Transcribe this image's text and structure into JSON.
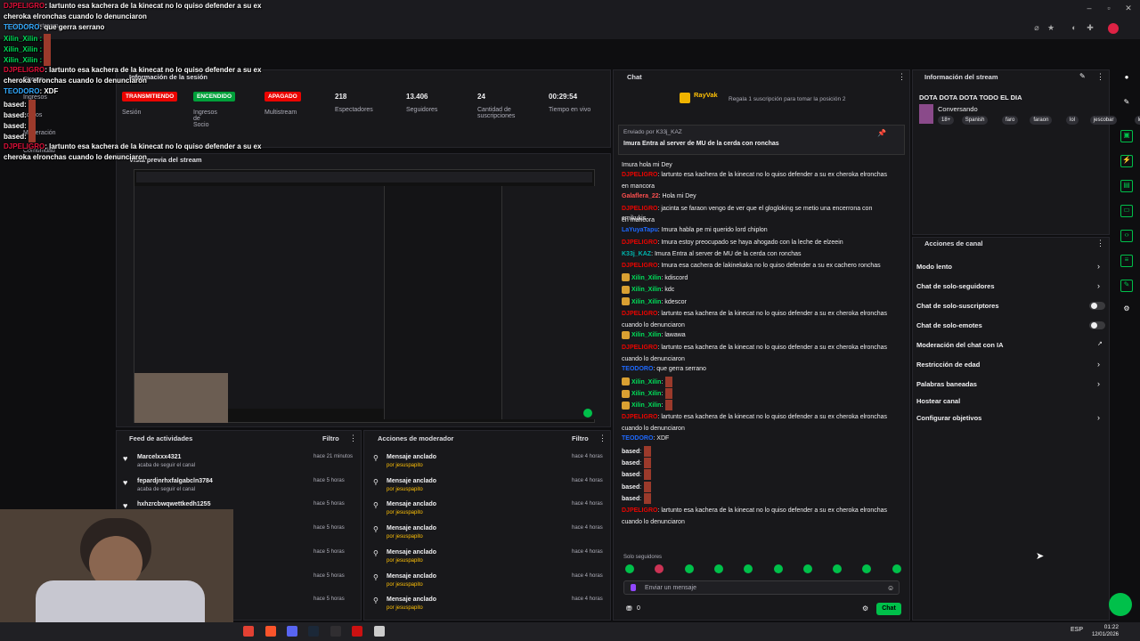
{
  "browser": {
    "url": "twitch.tv/…/stream"
  },
  "overlay": {
    "lines": [
      {
        "user": "DJPELIGRO",
        "text": ": lartunto esa kachera de la kinecat no lo quiso defender a su ex",
        "cont": "cheroka elronchas cuando lo denunciaron"
      },
      {
        "user": "TEODORO",
        "text": ": que gerra serrano"
      },
      {
        "user": "Xilin_Xilin :",
        "text": ""
      },
      {
        "user": "Xilin_Xilin :",
        "text": ""
      },
      {
        "user": "Xilin_Xilin :",
        "text": ""
      },
      {
        "user": "DJPELIGRO",
        "text": ": lartunto esa kachera de la kinecat no lo quiso defender a su ex",
        "cont": "cheroka elronchas cuando lo denunciaron"
      },
      {
        "user": "TEODORO",
        "text": ": XDF"
      },
      {
        "user": "based:",
        "text": ""
      },
      {
        "user": "based:",
        "text": ""
      },
      {
        "user": "based:",
        "text": ""
      },
      {
        "user": "based:",
        "text": ""
      },
      {
        "user": "DJPELIGRO",
        "text": ": lartunto esa kachera de la kinecat no lo quiso defender a su ex",
        "cont": "cheroka elronchas cuando lo denunciaron"
      }
    ]
  },
  "left_nav": [
    "Stream",
    "Ingresos",
    "Logros",
    "Moderación",
    "Comunidad"
  ],
  "session": {
    "title": "Información de la sesión",
    "badges": [
      {
        "label": "TRANSMITIENDO",
        "sub": "Sesión",
        "color": "#eb0400"
      },
      {
        "label": "ENCENDIDO",
        "sub": "Ingresos de Socio",
        "color": "#00a03a"
      },
      {
        "label": "APAGADO",
        "sub": "Multistream",
        "color": "#eb0400"
      }
    ],
    "stats": [
      {
        "num": "218",
        "lbl": "Espectadores"
      },
      {
        "num": "13.406",
        "lbl": "Seguidores"
      },
      {
        "num": "24",
        "lbl": "Cantidad de suscripciones"
      },
      {
        "num": "00:29:54",
        "lbl": "Tiempo en vivo"
      }
    ]
  },
  "preview": {
    "title": "Vista previa del stream"
  },
  "feed": {
    "title": "Feed de actividades",
    "filter": "Filtro",
    "items": [
      {
        "name": "Marcelxxx4321",
        "sub": "acaba de seguir el canal",
        "time": "hace 21 minutos"
      },
      {
        "name": "fepardjnrhxfalgabcln3784",
        "sub": "acaba de seguir el canal",
        "time": "hace 5 horas"
      },
      {
        "name": "hxhzrcbwqwettkedh1255",
        "sub": "",
        "time": "hace 5 horas"
      },
      {
        "name": "",
        "sub": "",
        "time": "hace 5 horas"
      },
      {
        "name": "",
        "sub": "",
        "time": "hace 5 horas"
      },
      {
        "name": "",
        "sub": "",
        "time": "hace 5 horas"
      },
      {
        "name": "",
        "sub": "",
        "time": "hace 5 horas"
      }
    ]
  },
  "mod": {
    "title": "Acciones de moderador",
    "filter": "Filtro",
    "items": [
      {
        "name": "Mensaje anclado",
        "by": "por jesuspapito",
        "time": "hace 4 horas"
      },
      {
        "name": "Mensaje anclado",
        "by": "por jesuspapito",
        "time": "hace 4 horas"
      },
      {
        "name": "Mensaje anclado",
        "by": "por jesuspapito",
        "time": "hace 4 horas"
      },
      {
        "name": "Mensaje anclado",
        "by": "por jesuspapito",
        "time": "hace 4 horas"
      },
      {
        "name": "Mensaje anclado",
        "by": "por jesuspapito",
        "time": "hace 4 horas"
      },
      {
        "name": "Mensaje anclado",
        "by": "por jesuspapito",
        "time": "hace 4 horas"
      },
      {
        "name": "Mensaje anclado",
        "by": "por jesuspapito",
        "time": "hace 4 horas"
      }
    ]
  },
  "chat": {
    "title": "Chat",
    "top_user": "RayVak",
    "gift_note": "Regala 1 suscripción para tomar la posición 2",
    "pinned_by": "Enviado por K33j_KAZ",
    "pinned_text": "Imura Entra al server de MU de la cerda con ronchas",
    "messages": [
      {
        "user": "",
        "text": "Imura hola mi Dey",
        "color": "#eb0400"
      },
      {
        "user": "DJPELIGRO",
        "text": ": lartunto esa kachera de la kinecat no lo quiso defender a su ex cheroka elronchas",
        "color": "#eb0400"
      },
      {
        "user": "",
        "text": "en mancora",
        "color": "#eb0400"
      },
      {
        "user": "Galaflera_22",
        "text": ": Hola mi Dey",
        "color": "#ff4f4f"
      },
      {
        "user": "DJPELIGRO",
        "text": ": jacinta se faraon vengo de ver que el glogloking se metio una encerrona con emikukis",
        "color": "#eb0400"
      },
      {
        "user": "",
        "text": "en mancora",
        "color": "#eb0400"
      },
      {
        "user": "LaYuyaTapu",
        "text": ": Imura habla pe mi querido lord chiplon",
        "color": "#1e69ff"
      },
      {
        "user": "DJPELIGRO",
        "text": ": Imura estoy preocupado se haya ahogado con la leche de elzeein",
        "color": "#eb0400"
      },
      {
        "user": "K33j_KAZ",
        "text": ": Imura Entra al server de MU de la cerda con ronchas",
        "color": "#00b5ad"
      },
      {
        "user": "DJPELIGRO",
        "text": ": Imura esa cachera de lakinekaka no lo quiso defender a su ex cachero ronchas",
        "color": "#eb0400"
      },
      {
        "user": "Xilin_Xilin",
        "text": ": kdiscord",
        "color": "#00e05a"
      },
      {
        "user": "Xilin_Xilin",
        "text": ": kdc",
        "color": "#00e05a"
      },
      {
        "user": "Xilin_Xilin",
        "text": ": kdescor",
        "color": "#00e05a"
      },
      {
        "user": "DJPELIGRO",
        "text": ": lartunto esa kachera de la kinecat no lo quiso defender a su ex cheroka elronchas",
        "color": "#eb0400"
      },
      {
        "user": "",
        "text": "cuando lo denunciaron",
        "color": "#eb0400"
      },
      {
        "user": "Xilin_Xilin",
        "text": ": lawawa",
        "color": "#00e05a"
      },
      {
        "user": "DJPELIGRO",
        "text": ": lartunto esa kachera de la kinecat no lo quiso defender a su ex cheroka elronchas",
        "color": "#eb0400"
      },
      {
        "user": "",
        "text": "cuando lo denunciaron",
        "color": "#eb0400"
      },
      {
        "user": "TEODORO",
        "text": ": que gerra serrano",
        "color": "#1e69ff"
      },
      {
        "user": "Xilin_Xilin",
        "text": ":",
        "color": "#00e05a"
      },
      {
        "user": "Xilin_Xilin",
        "text": ":",
        "color": "#00e05a"
      },
      {
        "user": "Xilin_Xilin",
        "text": ":",
        "color": "#00e05a"
      },
      {
        "user": "DJPELIGRO",
        "text": ": lartunto esa kachera de la kinecat no lo quiso defender a su ex cheroka elronchas",
        "color": "#eb0400"
      },
      {
        "user": "",
        "text": "cuando lo denunciaron",
        "color": "#eb0400"
      },
      {
        "user": "TEODORO",
        "text": ": XDF",
        "color": "#1e69ff"
      },
      {
        "user": "based",
        "text": ":",
        "color": "#efeff1"
      },
      {
        "user": "based",
        "text": ":",
        "color": "#efeff1"
      },
      {
        "user": "based",
        "text": ":",
        "color": "#efeff1"
      },
      {
        "user": "based",
        "text": ":",
        "color": "#efeff1"
      },
      {
        "user": "based",
        "text": ":",
        "color": "#efeff1"
      },
      {
        "user": "DJPELIGRO",
        "text": ": lartunto esa kachera de la kinecat no lo quiso defender a su ex cheroka elronchas",
        "color": "#eb0400"
      },
      {
        "user": "",
        "text": "cuando lo denunciaron",
        "color": "#eb0400"
      }
    ],
    "mode_note": "Solo seguidores",
    "input_placeholder": "Enviar un mensaje",
    "points": "0",
    "send_label": "Chat"
  },
  "stream_info": {
    "title": "Información del stream",
    "stream_title": "DOTA DOTA DOTA TODO EL DIA",
    "category": "Conversando",
    "tags": [
      "18+",
      "Spanish",
      "faro",
      "faraon",
      "lol",
      "jescobar",
      "lord"
    ]
  },
  "actions": {
    "title": "Acciones de canal",
    "items": [
      {
        "label": "Modo lento",
        "kind": "chev"
      },
      {
        "label": "Chat de solo-seguidores",
        "kind": "chev"
      },
      {
        "label": "Chat de solo-suscriptores",
        "kind": "toggle"
      },
      {
        "label": "Chat de solo-emotes",
        "kind": "toggle"
      },
      {
        "label": "Moderación del chat con IA",
        "kind": "ext"
      },
      {
        "label": "Restricción de edad",
        "kind": "chev"
      },
      {
        "label": "Palabras baneadas",
        "kind": "chev"
      },
      {
        "label": "Hostear canal",
        "kind": "none"
      },
      {
        "label": "Configurar objetivos",
        "kind": "chev"
      }
    ]
  },
  "taskbar": {
    "lang": "ESP",
    "time": "01:22",
    "date": "12/01/2026"
  }
}
